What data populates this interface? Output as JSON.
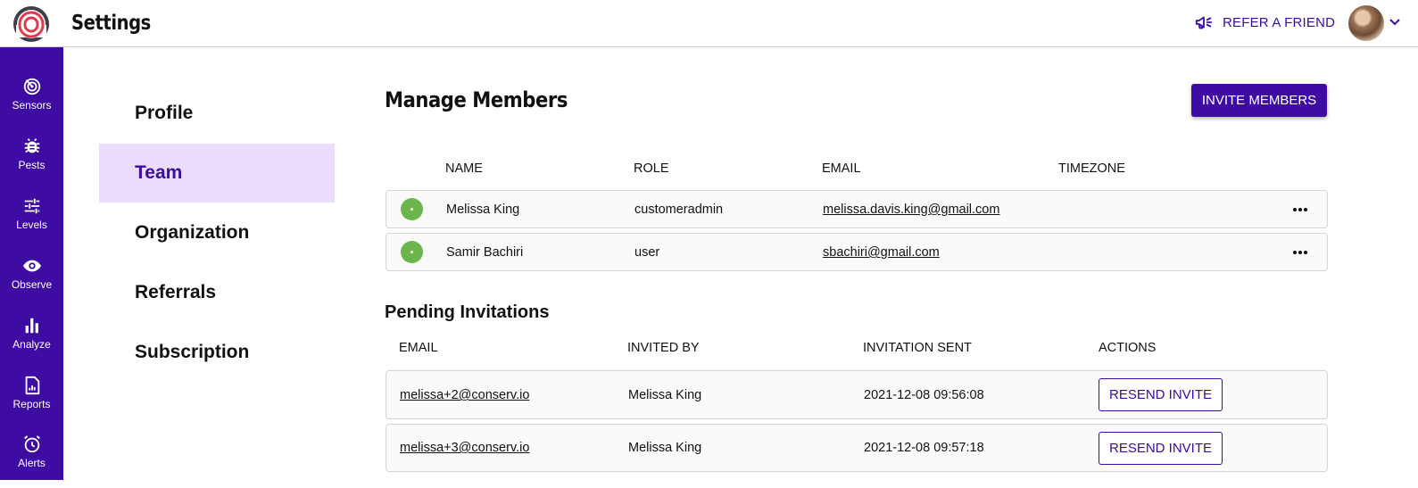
{
  "header": {
    "title": "Settings",
    "refer_label": "REFER A FRIEND",
    "logo_icon": "concentric-rings-logo",
    "refer_icon": "megaphone-icon"
  },
  "rail": {
    "items": [
      {
        "label": "Sensors",
        "icon": "sensor-icon"
      },
      {
        "label": "Pests",
        "icon": "bug-icon"
      },
      {
        "label": "Levels",
        "icon": "sliders-icon"
      },
      {
        "label": "Observe",
        "icon": "eye-icon"
      },
      {
        "label": "Analyze",
        "icon": "bar-chart-icon"
      },
      {
        "label": "Reports",
        "icon": "report-icon"
      },
      {
        "label": "Alerts",
        "icon": "alarm-icon"
      }
    ]
  },
  "settings_menu": {
    "items": [
      "Profile",
      "Team",
      "Organization",
      "Referrals",
      "Subscription"
    ],
    "active": "Team"
  },
  "members": {
    "title": "Manage Members",
    "invite_label": "INVITE MEMBERS",
    "columns": [
      "NAME",
      "ROLE",
      "EMAIL",
      "TIMEZONE"
    ],
    "rows": [
      {
        "name": "Melissa King",
        "role": "customeradmin",
        "email": "melissa.davis.king@gmail.com",
        "timezone": ""
      },
      {
        "name": "Samir Bachiri",
        "role": "user",
        "email": "sbachiri@gmail.com",
        "timezone": ""
      }
    ]
  },
  "invitations": {
    "title": "Pending Invitations",
    "columns": [
      "EMAIL",
      "INVITED BY",
      "INVITATION SENT",
      "ACTIONS"
    ],
    "rows": [
      {
        "email": "melissa+2@conserv.io",
        "invited_by": "Melissa King",
        "sent": "2021-12-08 09:56:08",
        "action": "RESEND INVITE"
      },
      {
        "email": "melissa+3@conserv.io",
        "invited_by": "Melissa King",
        "sent": "2021-12-08 09:57:18",
        "action": "RESEND INVITE"
      }
    ]
  },
  "colors": {
    "brand": "#3f0ca3",
    "active_menu_bg": "#eadcfc",
    "status_online": "#6bb64a"
  }
}
